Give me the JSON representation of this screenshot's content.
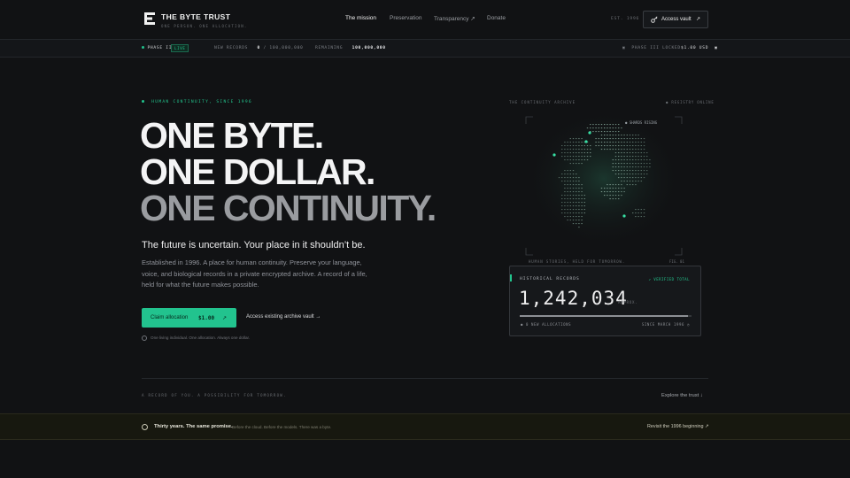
{
  "brand": {
    "title": "THE BYTE TRUST",
    "subtitle": "ONE PERSON. ONE ALLOCATION."
  },
  "nav": {
    "links": [
      "The mission",
      "Preservation",
      "Transparency ↗",
      "Donate"
    ],
    "est": "EST. 1996",
    "vault_button": "Access vault",
    "arrow": "↗"
  },
  "status": {
    "phase": "PHASE II",
    "live": "LIVE",
    "new_records_label": "NEW RECORDS",
    "new_records_value": "0",
    "new_records_total": "/ 100,000,000",
    "remaining_label": "REMAINING",
    "remaining_value": "100,000,000",
    "locked": "PHASE III LOCKED",
    "price": "$1.00 USD"
  },
  "hero": {
    "eyebrow": "HUMAN CONTINUITY, SINCE 1996",
    "line1": "ONE BYTE.",
    "line2": "ONE DOLLAR.",
    "line3": "ONE CONTINUITY.",
    "tagline": "The future is uncertain. Your place in it shouldn’t be.",
    "body": "Established in 1996. A place for human continuity. Preserve your language, voice, and biological records in a private encrypted archive. A record of a life, held for what the future makes possible.",
    "claim_label": "Claim allocation",
    "claim_price": "$1.00",
    "claim_arrow": "↗",
    "access_link": "Access existing archive vault  →",
    "note": "One living individual. One allocation. Always one dollar."
  },
  "archive": {
    "top_left": "THE CONTINUITY ARCHIVE",
    "top_right": "● REGISTRY ONLINE",
    "marker": "● SHARDS RISING",
    "caption_left": "HUMAN STORIES, HELD FOR TOMORROW.",
    "caption_right": "FIG. 01",
    "card_title": "HISTORICAL RECORDS",
    "card_verified": "↗ VERIFIED TOTAL",
    "card_number": "1,242,034",
    "card_approx": "APPROX.",
    "progress": 0.98,
    "new_allocations": "● 0 NEW ALLOCATIONS",
    "since": "SINCE MARCH 1996 ◷"
  },
  "footer": {
    "left": "A RECORD OF YOU. A POSSIBILITY FOR TOMORROW.",
    "right": "Explore the trust  ↓"
  },
  "banner": {
    "title": "Thirty years. The same promise.",
    "subtitle": "Before the cloud. Before the models. There was a byte.",
    "link": "Revisit the 1996 beginning  ↗"
  },
  "colors": {
    "accent": "#22c38e",
    "background": "#111214",
    "banner": "#17180f"
  }
}
